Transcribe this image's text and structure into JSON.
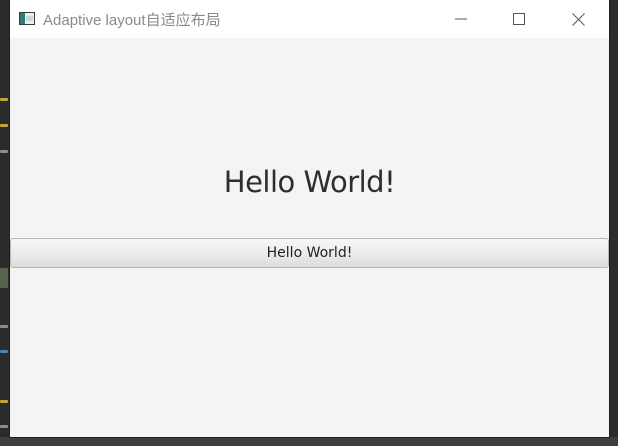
{
  "window": {
    "title": "Adaptive layout自适应布局"
  },
  "content": {
    "label_text": "Hello World!",
    "button_label": "Hello World!"
  },
  "icons": {
    "app": "app-window-icon",
    "minimize": "minimize-icon",
    "maximize": "maximize-icon",
    "close": "close-icon"
  },
  "colors": {
    "titlebar_bg": "#ffffff",
    "content_bg": "#f4f4f4",
    "title_text": "#8a8a8a",
    "label_text": "#2e2e2e"
  }
}
